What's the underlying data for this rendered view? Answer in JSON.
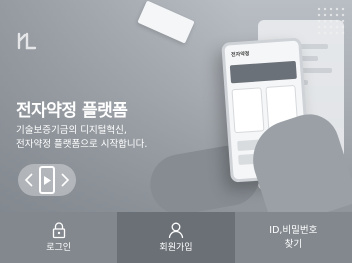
{
  "hero": {
    "title": "전자약정 플랫폼",
    "subtitle_line1": "기술보증기금의 디지털혁신,",
    "subtitle_line2": "전자약정 플랫폼으로 시작합니다.",
    "phone_header": "전자약정",
    "logo_icon": "kibo-logo-icon"
  },
  "slider": {
    "prev_icon": "chevron-left-icon",
    "play_icon": "play-icon",
    "next_icon": "chevron-right-icon"
  },
  "bottom_nav": {
    "items": [
      {
        "label": "로그인",
        "icon": "lock-icon"
      },
      {
        "label": "회원가입",
        "icon": "user-icon"
      },
      {
        "label_line1": "ID,비밀번호",
        "label_line2": "찾기"
      }
    ]
  },
  "colors": {
    "bottom_bar": "#83888e",
    "bottom_bar_active": "#6b7076",
    "text": "#ffffff"
  }
}
